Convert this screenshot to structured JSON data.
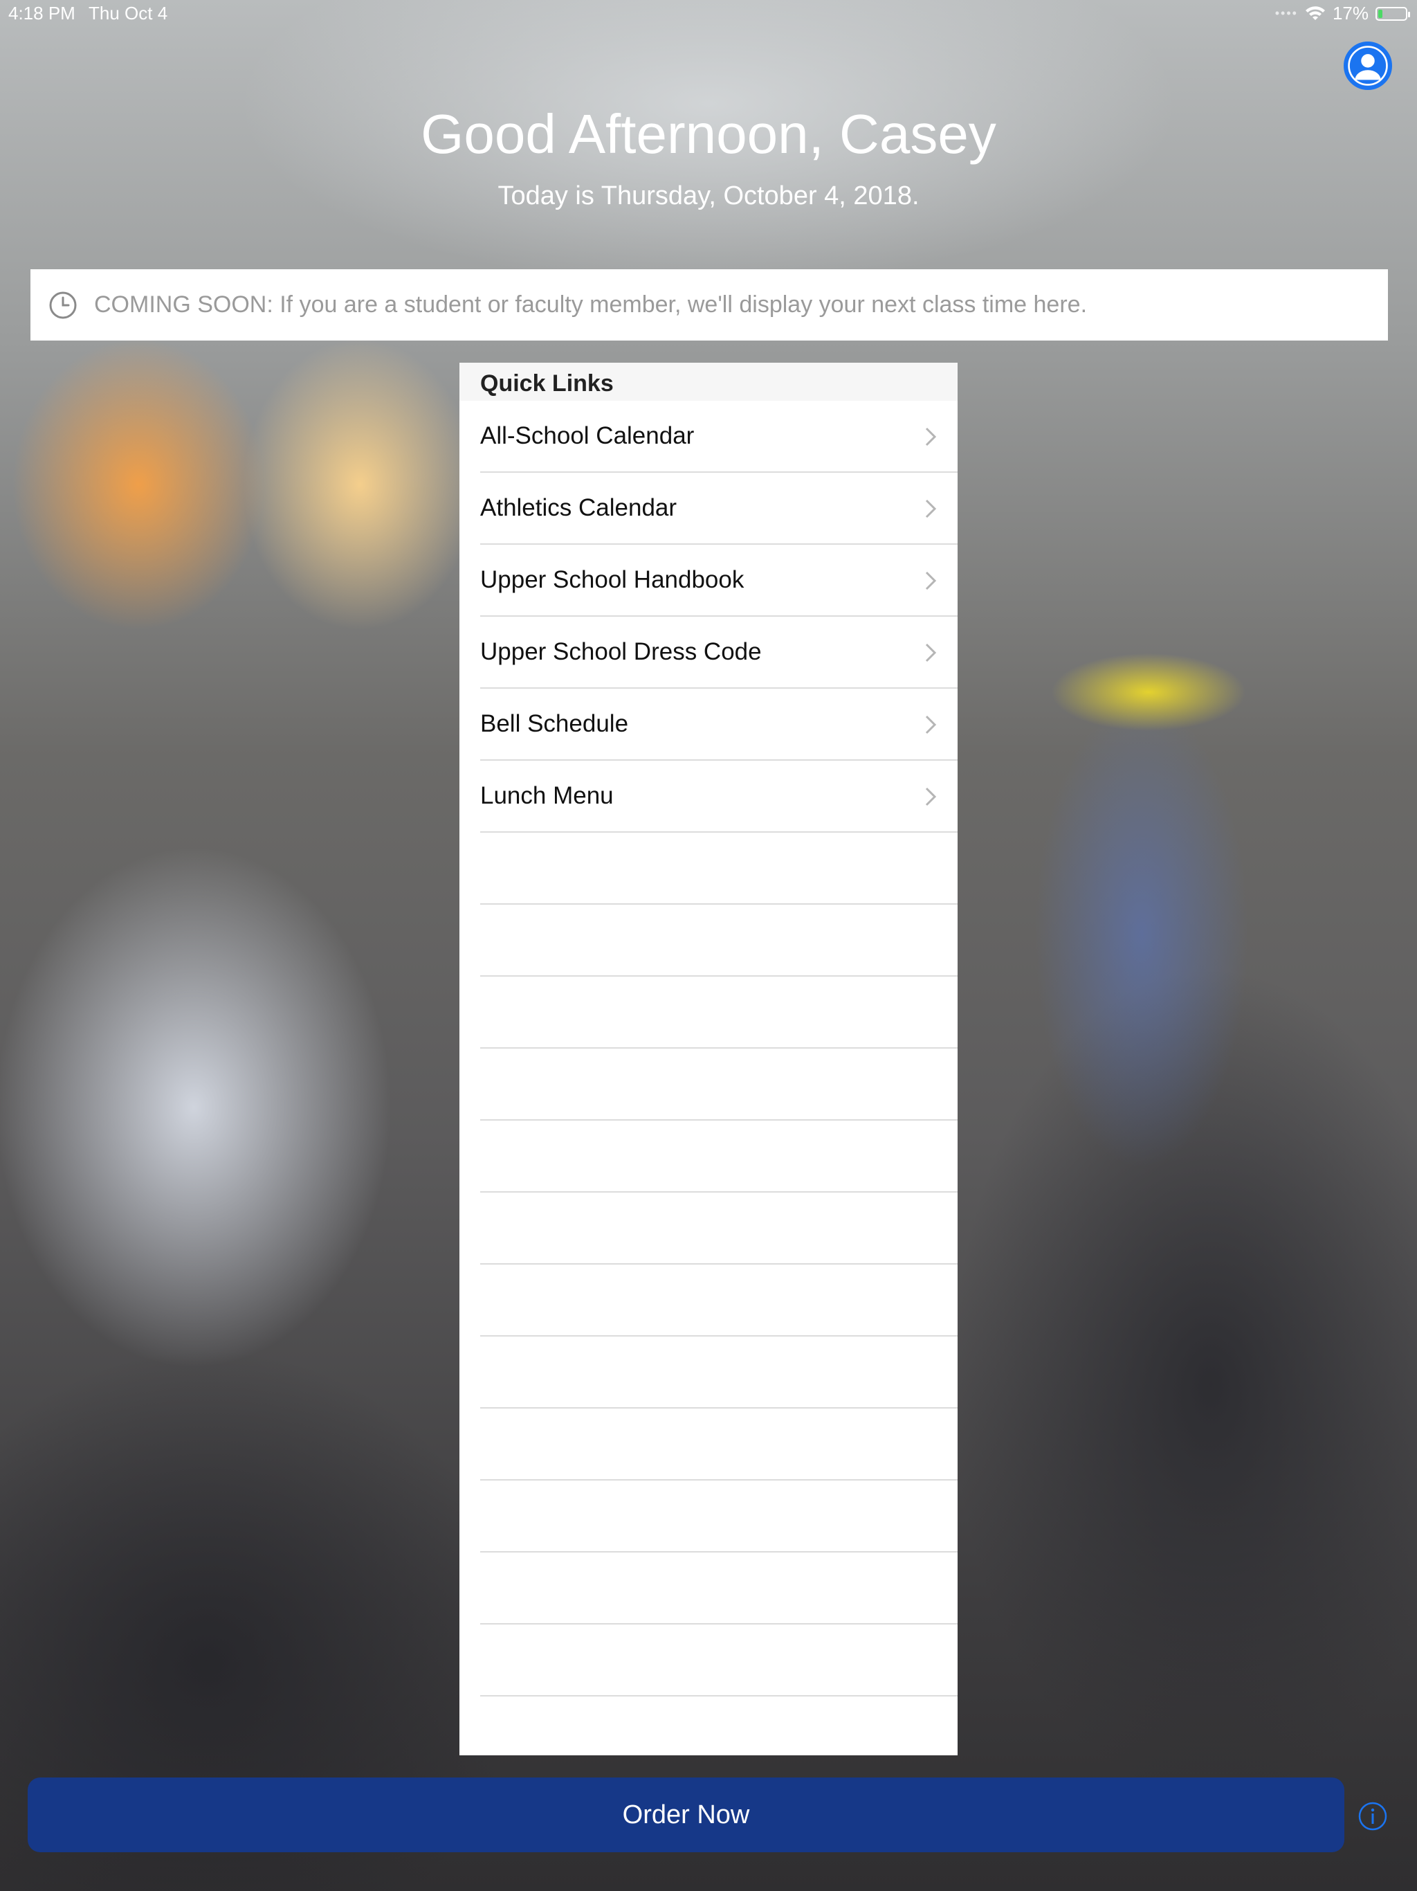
{
  "status_bar": {
    "time": "4:18 PM",
    "date": "Thu Oct 4",
    "battery_percent": "17%",
    "battery_level": 0.17
  },
  "header": {
    "greeting": "Good Afternoon, Casey",
    "date_line": "Today is Thursday, October 4, 2018."
  },
  "notice": {
    "icon": "clock-icon",
    "text": "COMING SOON: If you are a student or faculty member, we'll display your next class time here."
  },
  "quick_links": {
    "title": "Quick Links",
    "items": [
      {
        "label": "All-School Calendar"
      },
      {
        "label": "Athletics Calendar"
      },
      {
        "label": "Upper School Handbook"
      },
      {
        "label": "Upper School Dress Code"
      },
      {
        "label": "Bell Schedule"
      },
      {
        "label": "Lunch Menu"
      }
    ]
  },
  "footer": {
    "order_label": "Order Now",
    "info_icon": "info-icon"
  },
  "colors": {
    "accent_blue": "#1b74f0",
    "order_button": "#163888",
    "battery_fill": "#4cd964"
  }
}
